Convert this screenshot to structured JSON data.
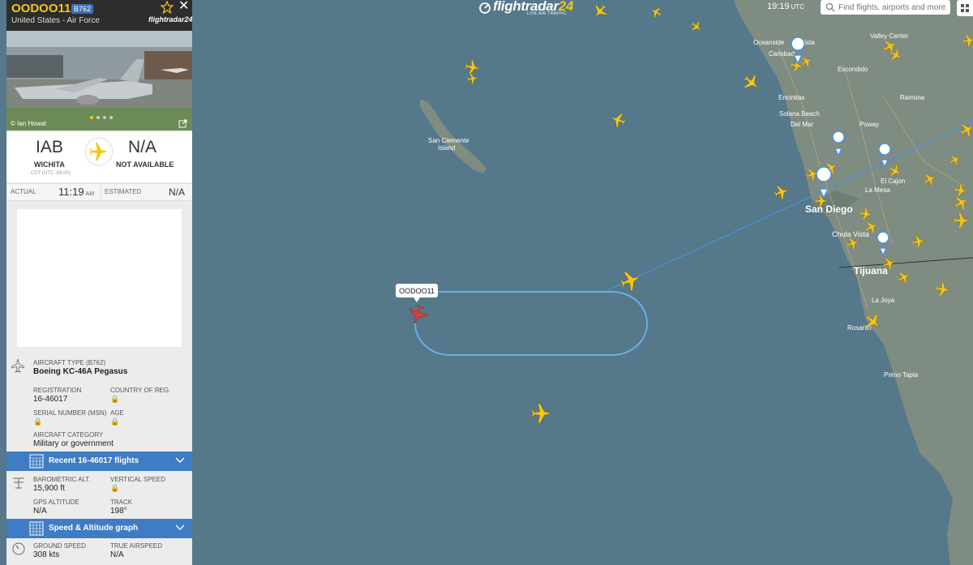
{
  "header": {
    "logo_name": "flightradar",
    "logo_num": "24",
    "logo_sub": "LIVE AIR TRAFFIC",
    "clock": "19:19",
    "clock_tz": "UTC",
    "search_placeholder": "Find flights, airports and more"
  },
  "panel": {
    "callsign": "OODOO11",
    "type_badge": "B762",
    "operator": "United States - Air Force",
    "brand": "flightradar24",
    "photo_credit": "© Ian Howat",
    "origin": {
      "code": "IAB",
      "city": "WICHITA",
      "tz": "CDT (UTC -05:00)"
    },
    "destination": {
      "code": "N/A",
      "city": "NOT AVAILABLE"
    },
    "actual_label": "ACTUAL",
    "actual_time": "11:19",
    "actual_ampm": "AM",
    "estimated_label": "ESTIMATED",
    "estimated_time": "N/A",
    "aircraft_type_label": "AIRCRAFT TYPE (B762)",
    "aircraft_type": "Boeing KC-46A Pegasus",
    "registration_label": "REGISTRATION",
    "registration": "16-46017",
    "country_label": "COUNTRY OF REG.",
    "serial_label": "SERIAL NUMBER (MSN)",
    "age_label": "AGE",
    "category_label": "AIRCRAFT CATEGORY",
    "category": "Military or government",
    "recent_flights_label": "Recent 16-46017 flights",
    "baro_alt_label": "BAROMETRIC ALT.",
    "baro_alt": "15,900 ft",
    "vert_speed_label": "VERTICAL SPEED",
    "gps_alt_label": "GPS ALTITUDE",
    "gps_alt": "N/A",
    "track_label": "TRACK",
    "track": "198°",
    "graph_label": "Speed & Altitude graph",
    "ground_speed_label": "GROUND SPEED",
    "ground_speed": "308 kts",
    "true_airspeed_label": "TRUE AIRSPEED",
    "true_airspeed": "N/A"
  },
  "map": {
    "selected_flight_tag": "OODOO11",
    "places": [
      "San Clemente Island",
      "Oceanside",
      "Vista",
      "Carlsbad",
      "Escondido",
      "Valley Center",
      "Encinitas",
      "Solana Beach",
      "Del Mar",
      "Poway",
      "Ramona",
      "El Cajon",
      "La Mesa",
      "San Diego",
      "Chula Vista",
      "Tijuana",
      "La Joya",
      "Rosarito",
      "Primo Tapia"
    ]
  },
  "colors": {
    "sea": "#55788a",
    "land": "#7d8a80",
    "track": "#6aaeea",
    "plane": "#f5c518",
    "selected_plane": "#e0403a",
    "panel_bar": "#3e7cc4"
  }
}
